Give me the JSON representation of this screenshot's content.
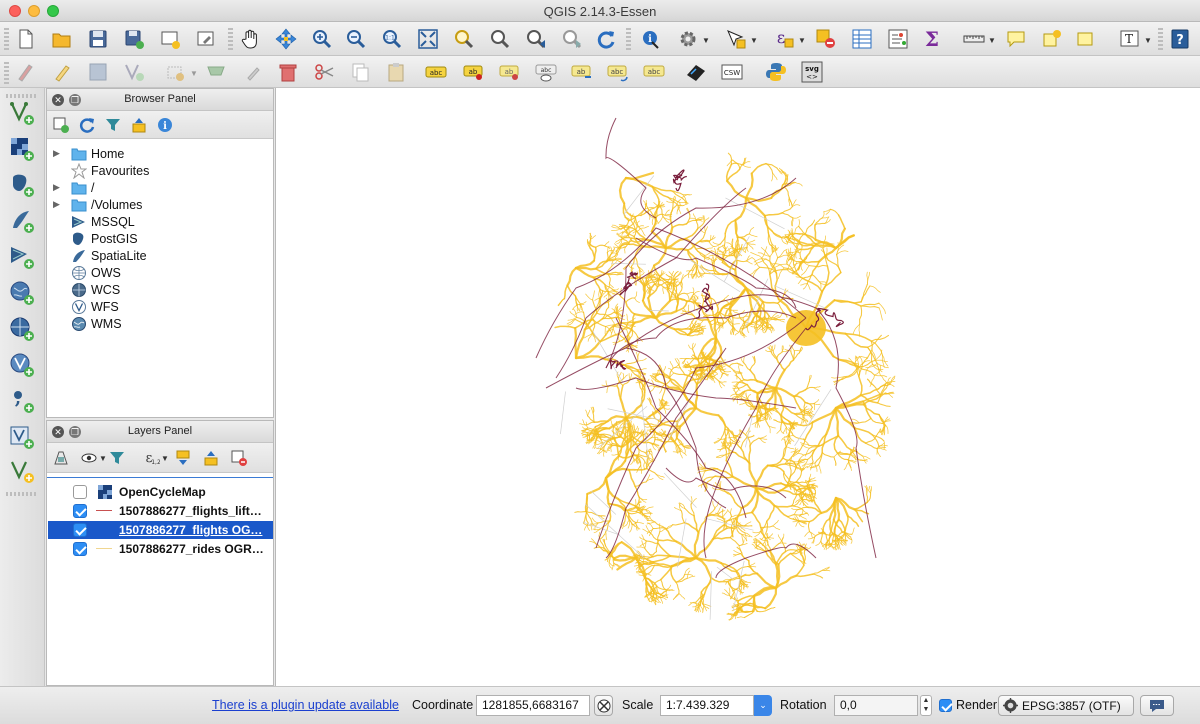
{
  "window": {
    "title": "QGIS 2.14.3-Essen"
  },
  "colors": {
    "selection": "#1a58c9",
    "rides": "#f5c022",
    "flights": "#7a1e3c",
    "link": "#1a3fcf"
  },
  "browser_panel": {
    "title": "Browser Panel",
    "items": [
      {
        "label": "Home",
        "icon": "folder-icon",
        "expandable": true
      },
      {
        "label": "Favourites",
        "icon": "star-icon",
        "expandable": false
      },
      {
        "label": "/",
        "icon": "folder-icon",
        "expandable": true
      },
      {
        "label": "/Volumes",
        "icon": "folder-icon",
        "expandable": true
      },
      {
        "label": "MSSQL",
        "icon": "mssql-icon",
        "expandable": false
      },
      {
        "label": "PostGIS",
        "icon": "postgis-icon",
        "expandable": false
      },
      {
        "label": "SpatiaLite",
        "icon": "spatialite-icon",
        "expandable": false
      },
      {
        "label": "OWS",
        "icon": "ows-globe-icon",
        "expandable": false
      },
      {
        "label": "WCS",
        "icon": "wcs-globe-icon",
        "expandable": false
      },
      {
        "label": "WFS",
        "icon": "wfs-globe-icon",
        "expandable": false
      },
      {
        "label": "WMS",
        "icon": "wms-globe-icon",
        "expandable": false
      }
    ]
  },
  "layers_panel": {
    "title": "Layers Panel",
    "layers": [
      {
        "label": "OpenCycleMap",
        "checked": false,
        "selected": false,
        "symbol": "raster-icon"
      },
      {
        "label": "1507886277_flights_lift…",
        "checked": true,
        "selected": false,
        "symbol": "line-red"
      },
      {
        "label": "1507886277_flights OG…",
        "checked": true,
        "selected": true,
        "symbol": "line-none"
      },
      {
        "label": "1507886277_rides OGR…",
        "checked": true,
        "selected": false,
        "symbol": "line-yellow"
      }
    ]
  },
  "statusbar": {
    "plugin_update": "There is a plugin update available",
    "coordinate_label": "Coordinate",
    "coordinate_value": "1281855,6683167",
    "scale_label": "Scale",
    "scale_value": "1:7.439.329",
    "rotation_label": "Rotation",
    "rotation_value": "0,0",
    "render_label": "Render",
    "render_checked": true,
    "crs_value": "EPSG:3857 (OTF)"
  }
}
